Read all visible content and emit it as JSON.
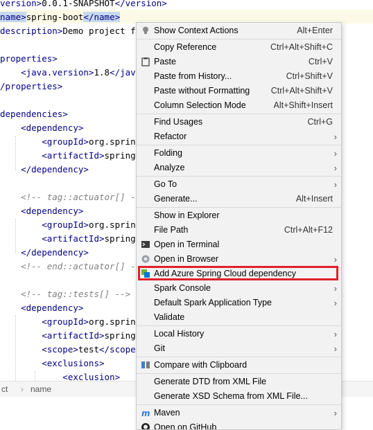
{
  "editor": {
    "lines": [
      {
        "pre": "version>",
        "mid": "0.0.1-SNAPSHOT",
        "post": "</version>"
      },
      {
        "pre": "name>",
        "mid": "spring-boot",
        "post": "</name>"
      },
      {
        "pre": "description>",
        "mid": "Demo project for",
        "post": ""
      },
      {
        "pre": "",
        "mid": "",
        "post": ""
      },
      {
        "pre": "properties>",
        "mid": "",
        "post": ""
      },
      {
        "pre": "    <java.version>",
        "mid": "1.8",
        "post": "</java.v"
      },
      {
        "pre": "/properties>",
        "mid": "",
        "post": ""
      },
      {
        "pre": "",
        "mid": "",
        "post": ""
      },
      {
        "pre": "dependencies>",
        "mid": "",
        "post": ""
      },
      {
        "pre": "    <dependency>",
        "mid": "",
        "post": ""
      },
      {
        "pre": "        <groupId>",
        "mid": "org.springfr",
        "post": ""
      },
      {
        "pre": "        <artifactId>",
        "mid": "spring-bo",
        "post": ""
      },
      {
        "pre": "    </dependency>",
        "mid": "",
        "post": ""
      },
      {
        "pre": "",
        "mid": "",
        "post": ""
      },
      {
        "comment": "    <!-- tag::actuator[] -->"
      },
      {
        "pre": "    <dependency>",
        "mid": "",
        "post": ""
      },
      {
        "pre": "        <groupId>",
        "mid": "org.springfr",
        "post": ""
      },
      {
        "pre": "        <artifactId>",
        "mid": "spring-bo",
        "post": ""
      },
      {
        "pre": "    </dependency>",
        "mid": "",
        "post": ""
      },
      {
        "comment": "    <!-- end::actuator[] -->"
      },
      {
        "pre": "",
        "mid": "",
        "post": ""
      },
      {
        "comment": "    <!-- tag::tests[] -->"
      },
      {
        "pre": "    <dependency>",
        "mid": "",
        "post": ""
      },
      {
        "pre": "        <groupId>",
        "mid": "org.springfr",
        "post": ""
      },
      {
        "pre": "        <artifactId>",
        "mid": "spring-bo",
        "post": ""
      },
      {
        "pre": "        <scope>",
        "mid": "test",
        "post": "</scope>"
      },
      {
        "pre": "        <exclusions>",
        "mid": "",
        "post": ""
      },
      {
        "pre": "            <exclusion>",
        "mid": "",
        "post": ""
      }
    ]
  },
  "breadcrumb": {
    "first": "ct",
    "separator": "›",
    "second": "name"
  },
  "menu": {
    "items": [
      {
        "label": "Show Context Actions",
        "shortcut": "Alt+Enter",
        "icon": "bulb-icon"
      },
      {
        "label": "Copy Reference",
        "shortcut": "Ctrl+Alt+Shift+C"
      },
      {
        "label": "Paste",
        "shortcut": "Ctrl+V",
        "icon": "clipboard-icon"
      },
      {
        "label": "Paste from History...",
        "shortcut": "Ctrl+Shift+V"
      },
      {
        "label": "Paste without Formatting",
        "shortcut": "Ctrl+Alt+Shift+V"
      },
      {
        "label": "Column Selection Mode",
        "shortcut": "Alt+Shift+Insert"
      },
      {
        "label": "Find Usages",
        "shortcut": "Ctrl+G"
      },
      {
        "label": "Refactor",
        "submenu": true
      },
      {
        "label": "Folding",
        "submenu": true
      },
      {
        "label": "Analyze",
        "submenu": true
      },
      {
        "label": "Go To",
        "submenu": true
      },
      {
        "label": "Generate...",
        "shortcut": "Alt+Insert"
      },
      {
        "label": "Show in Explorer"
      },
      {
        "label": "File Path",
        "shortcut": "Ctrl+Alt+F12"
      },
      {
        "label": "Open in Terminal",
        "icon": "terminal-icon"
      },
      {
        "label": "Open in Browser",
        "submenu": true,
        "icon": "browser-icon"
      },
      {
        "label": "Add Azure Spring Cloud dependency",
        "icon": "azure-spring-icon"
      },
      {
        "label": "Spark Console",
        "submenu": true
      },
      {
        "label": "Default Spark Application Type",
        "submenu": true
      },
      {
        "label": "Validate"
      },
      {
        "label": "Local History",
        "submenu": true
      },
      {
        "label": "Git",
        "submenu": true
      },
      {
        "label": "Compare with Clipboard",
        "icon": "compare-icon"
      },
      {
        "label": "Generate DTD from XML File"
      },
      {
        "label": "Generate XSD Schema from XML File..."
      },
      {
        "label": "Maven",
        "submenu": true,
        "icon": "maven-icon"
      },
      {
        "label": "Open on GitHub",
        "icon": "github-icon"
      }
    ],
    "highlight_color": "#e0202a"
  }
}
